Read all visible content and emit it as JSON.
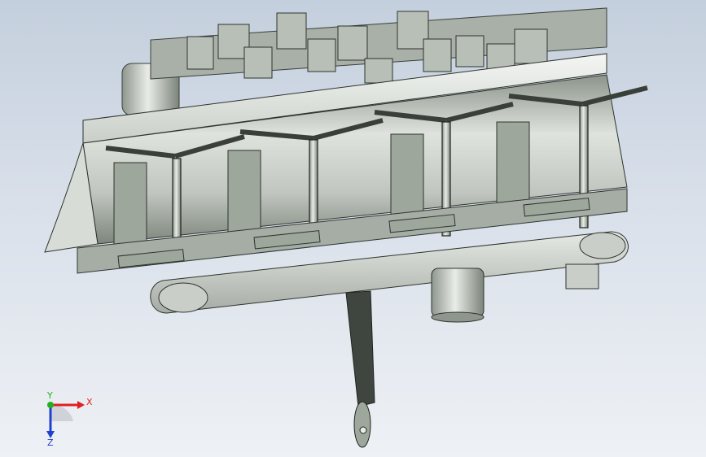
{
  "viewport": {
    "background_top": "#c4cfdd",
    "background_bottom": "#eef1f5"
  },
  "triad": {
    "x_label": "X",
    "y_label": "Y",
    "z_label": "Z",
    "x_color": "#e02020",
    "y_color": "#20b020",
    "z_color": "#2040d0"
  },
  "model": {
    "frame_color": "#9ea79b",
    "light_color": "#e8ece6",
    "dark_color": "#404540",
    "rotor_count": 4
  }
}
